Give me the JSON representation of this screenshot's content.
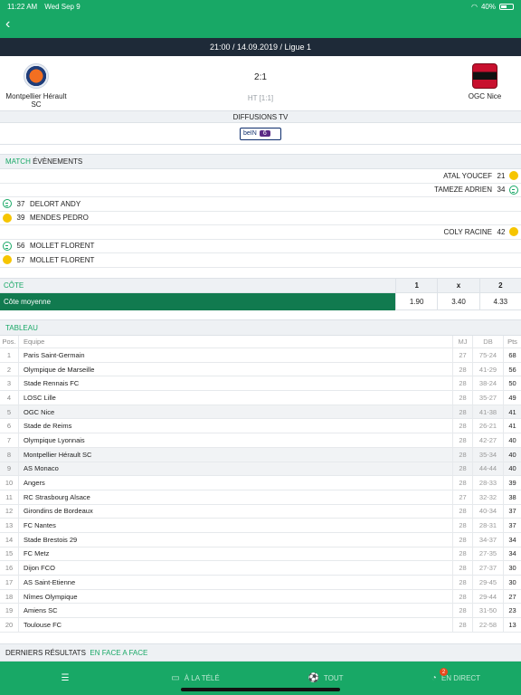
{
  "status_bar": {
    "time": "11:22 AM",
    "date": "Wed Sep 9",
    "battery": "40%"
  },
  "match_header": {
    "info": "21:00 / 14.09.2019 / Ligue 1"
  },
  "teams": {
    "home": {
      "name": "Montpellier Hérault SC"
    },
    "away": {
      "name": "OGC Nice"
    },
    "score": "2:1",
    "halftime": "HT [1:1]"
  },
  "tv": {
    "section_title": "DIFFUSIONS TV",
    "channel_name": "beIN",
    "channel_number": "6"
  },
  "events_section": {
    "tab_match": "MATCH",
    "tab_events": "ÉVÈNEMENTS"
  },
  "events": [
    {
      "side": "right",
      "minute": "21",
      "player": "ATAL YOUCEF",
      "icon": "yellow-card-icon"
    },
    {
      "side": "right",
      "minute": "34",
      "player": "TAMEZE ADRIEN",
      "icon": "goal-icon"
    },
    {
      "side": "left",
      "minute": "37",
      "player": "DELORT ANDY",
      "icon": "goal-icon"
    },
    {
      "side": "left",
      "minute": "39",
      "player": "MENDES PEDRO",
      "icon": "yellow-card-icon"
    },
    {
      "side": "right",
      "minute": "42",
      "player": "COLY RACINE",
      "icon": "yellow-card-icon"
    },
    {
      "side": "left",
      "minute": "56",
      "player": "MOLLET FLORENT",
      "icon": "goal-icon"
    },
    {
      "side": "left",
      "minute": "57",
      "player": "MOLLET FLORENT",
      "icon": "yellow-card-icon"
    }
  ],
  "odds": {
    "title": "CÔTE",
    "headers": [
      "1",
      "x",
      "2"
    ],
    "label": "Côte moyenne",
    "values": [
      "1.90",
      "3.40",
      "4.33"
    ]
  },
  "standings": {
    "title": "TABLEAU",
    "headers": {
      "pos": "Pos.",
      "team": "Equipe",
      "mj": "MJ",
      "db": "DB",
      "pts": "Pts"
    },
    "rows": [
      {
        "pos": "1",
        "team": "Paris Saint-Germain",
        "mj": "27",
        "db": "75-24",
        "pts": "68"
      },
      {
        "pos": "2",
        "team": "Olympique de Marseille",
        "mj": "28",
        "db": "41-29",
        "pts": "56"
      },
      {
        "pos": "3",
        "team": "Stade Rennais FC",
        "mj": "28",
        "db": "38-24",
        "pts": "50"
      },
      {
        "pos": "4",
        "team": "LOSC Lille",
        "mj": "28",
        "db": "35-27",
        "pts": "49"
      },
      {
        "pos": "5",
        "team": "OGC Nice",
        "mj": "28",
        "db": "41-38",
        "pts": "41"
      },
      {
        "pos": "6",
        "team": "Stade de Reims",
        "mj": "28",
        "db": "26-21",
        "pts": "41"
      },
      {
        "pos": "7",
        "team": "Olympique Lyonnais",
        "mj": "28",
        "db": "42-27",
        "pts": "40"
      },
      {
        "pos": "8",
        "team": "Montpellier Hérault SC",
        "mj": "28",
        "db": "35-34",
        "pts": "40"
      },
      {
        "pos": "9",
        "team": "AS Monaco",
        "mj": "28",
        "db": "44-44",
        "pts": "40"
      },
      {
        "pos": "10",
        "team": "Angers",
        "mj": "28",
        "db": "28-33",
        "pts": "39"
      },
      {
        "pos": "11",
        "team": "RC Strasbourg Alsace",
        "mj": "27",
        "db": "32-32",
        "pts": "38"
      },
      {
        "pos": "12",
        "team": "Girondins de Bordeaux",
        "mj": "28",
        "db": "40-34",
        "pts": "37"
      },
      {
        "pos": "13",
        "team": "FC Nantes",
        "mj": "28",
        "db": "28-31",
        "pts": "37"
      },
      {
        "pos": "14",
        "team": "Stade Brestois 29",
        "mj": "28",
        "db": "34-37",
        "pts": "34"
      },
      {
        "pos": "15",
        "team": "FC Metz",
        "mj": "28",
        "db": "27-35",
        "pts": "34"
      },
      {
        "pos": "16",
        "team": "Dijon FCO",
        "mj": "28",
        "db": "27-37",
        "pts": "30"
      },
      {
        "pos": "17",
        "team": "AS Saint-Etienne",
        "mj": "28",
        "db": "29-45",
        "pts": "30"
      },
      {
        "pos": "18",
        "team": "Nîmes Olympique",
        "mj": "28",
        "db": "29-44",
        "pts": "27"
      },
      {
        "pos": "19",
        "team": "Amiens SC",
        "mj": "28",
        "db": "31-50",
        "pts": "23"
      },
      {
        "pos": "20",
        "team": "Toulouse FC",
        "mj": "28",
        "db": "22-58",
        "pts": "13"
      }
    ]
  },
  "results_section": {
    "tab_last": "DERNIERS RÉSULTATS",
    "tab_h2h": "EN FACE A FACE"
  },
  "tabbar": {
    "items": [
      {
        "label": "",
        "icon": "list-icon"
      },
      {
        "label": "À LA TÉLÉ",
        "icon": "tv-icon"
      },
      {
        "label": "TOUT",
        "icon": "ball-icon"
      },
      {
        "label": "EN DIRECT",
        "icon": "live-icon",
        "badge": "2"
      }
    ]
  },
  "colors": {
    "accent": "#18a866",
    "dark_bar": "#1e2a38",
    "odds_bar": "#117a4f",
    "yellow_card": "#f6c500"
  }
}
